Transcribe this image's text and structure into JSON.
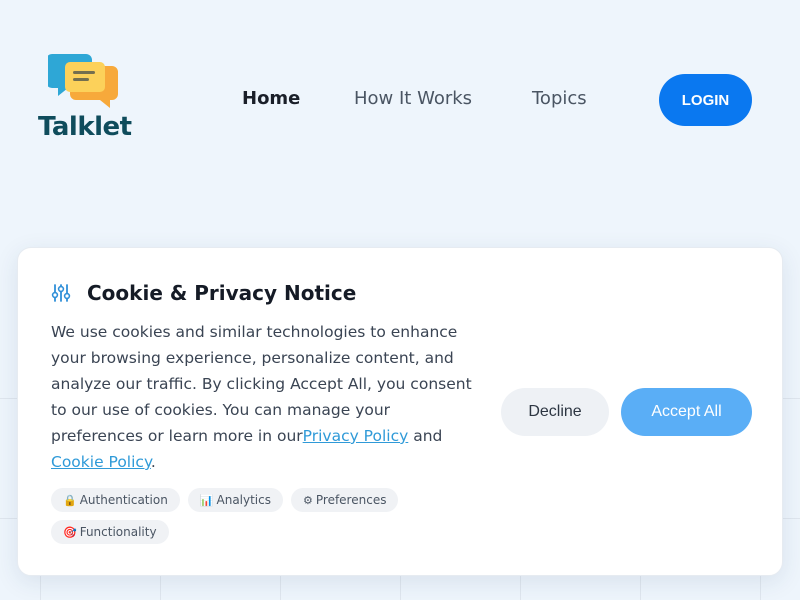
{
  "brand": {
    "name": "Talklet"
  },
  "nav": {
    "items": [
      {
        "label": "Home",
        "active": true
      },
      {
        "label": "How It Works",
        "active": false
      },
      {
        "label": "Topics",
        "active": false
      }
    ],
    "login_label": "LOGIN"
  },
  "cookie": {
    "title": "Cookie & Privacy Notice",
    "title_icon": "sliders-icon",
    "body_text": "We use cookies and similar technologies to enhance your browsing experience, personalize content, and analyze our traffic. By clicking Accept All, you consent to our use of cookies. You can manage your preferences or learn more in our",
    "privacy_link": "Privacy Policy",
    "and_text": " and ",
    "cookie_link": "Cookie Policy",
    "period": ".",
    "tags": [
      {
        "icon": "🔒",
        "label": "Authentication"
      },
      {
        "icon": "📊",
        "label": "Analytics"
      },
      {
        "icon": "⚙",
        "label": "Preferences"
      },
      {
        "icon": "🎯",
        "label": "Functionality"
      }
    ],
    "decline_label": "Decline",
    "accept_label": "Accept All"
  },
  "colors": {
    "accent": "#0a78f0",
    "accept": "#5aaef6",
    "link": "#2f9ad8",
    "brand_text": "#0f4c5c"
  }
}
